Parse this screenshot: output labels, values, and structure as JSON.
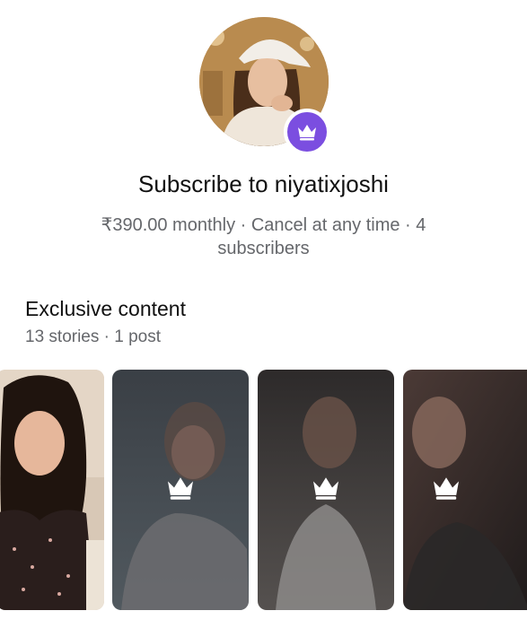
{
  "profile": {
    "avatar_icon": "profile-photo",
    "badge_icon": "crown-icon",
    "badge_color": "#7b4ee0"
  },
  "subscribe": {
    "title": "Subscribe to niyatixjoshi",
    "details": "₹390.00 monthly · Cancel at any time · 4 subscribers"
  },
  "exclusive": {
    "title": "Exclusive content",
    "counts": "13 stories · 1 post",
    "items": [
      {
        "type": "photo",
        "locked": false
      },
      {
        "type": "photo",
        "locked": true,
        "icon": "crown-icon"
      },
      {
        "type": "photo",
        "locked": true,
        "icon": "crown-icon"
      },
      {
        "type": "photo",
        "locked": true,
        "icon": "crown-icon"
      }
    ]
  }
}
